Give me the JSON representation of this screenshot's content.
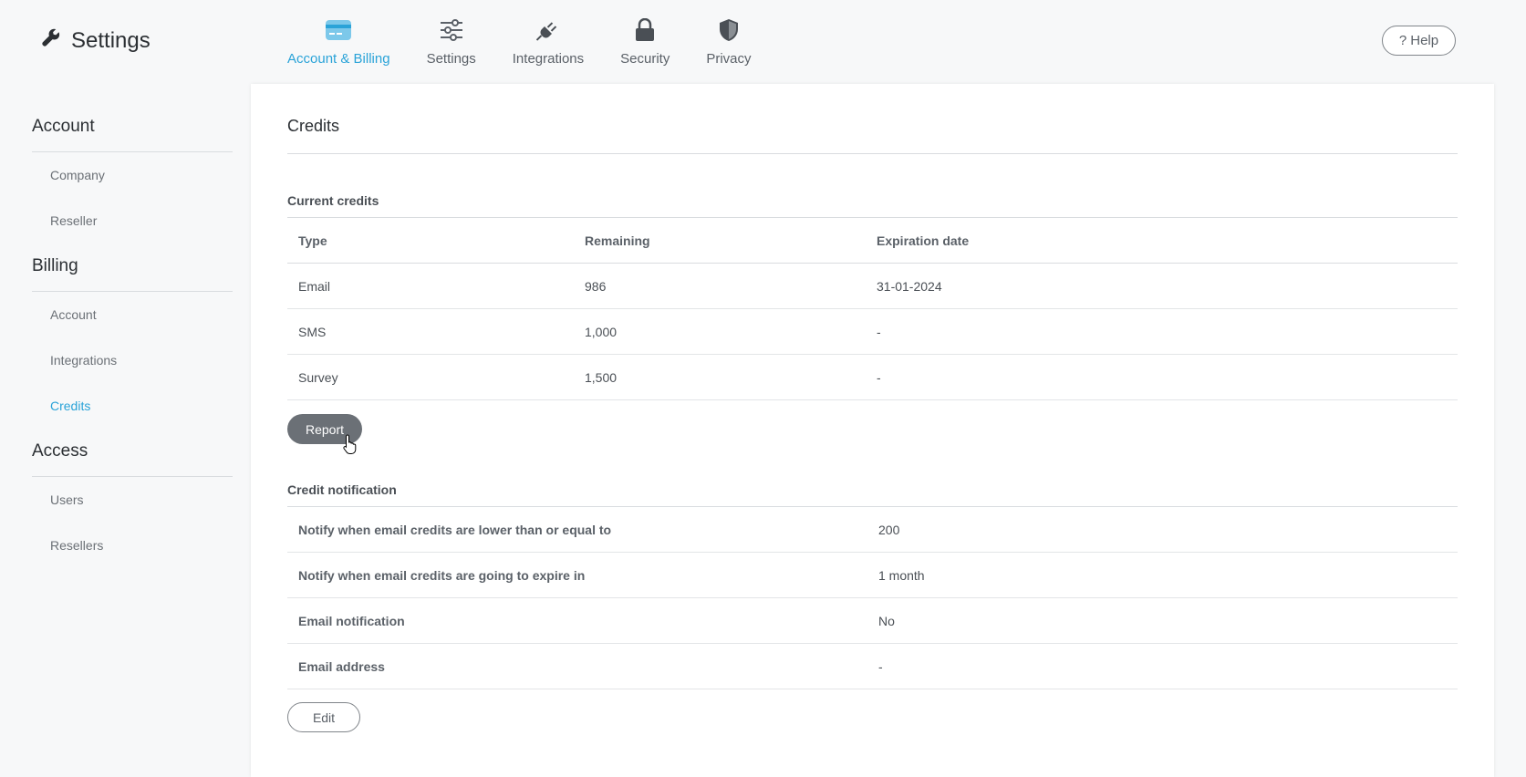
{
  "header": {
    "title": "Settings",
    "help_label": "Help",
    "tabs": [
      {
        "label": "Account & Billing",
        "icon": "credit-card-icon",
        "active": true
      },
      {
        "label": "Settings",
        "icon": "sliders-icon"
      },
      {
        "label": "Integrations",
        "icon": "plug-icon"
      },
      {
        "label": "Security",
        "icon": "lock-icon"
      },
      {
        "label": "Privacy",
        "icon": "shield-icon"
      }
    ]
  },
  "sidebar": {
    "sections": [
      {
        "title": "Account",
        "items": [
          "Company",
          "Reseller"
        ]
      },
      {
        "title": "Billing",
        "items": [
          "Account",
          "Integrations",
          "Credits"
        ]
      },
      {
        "title": "Access",
        "items": [
          "Users",
          "Resellers"
        ]
      }
    ],
    "active_item": "Credits"
  },
  "main": {
    "title": "Credits",
    "current_credits": {
      "title": "Current credits",
      "columns": [
        "Type",
        "Remaining",
        "Expiration date"
      ],
      "rows": [
        [
          "Email",
          "986",
          "31-01-2024"
        ],
        [
          "SMS",
          "1,000",
          "-"
        ],
        [
          "Survey",
          "1,500",
          "-"
        ]
      ],
      "report_label": "Report"
    },
    "credit_notification": {
      "title": "Credit notification",
      "rows": [
        [
          "Notify when email credits are lower than or equal to",
          "200"
        ],
        [
          "Notify when email credits are going to expire in",
          "1 month"
        ],
        [
          "Email notification",
          "No"
        ],
        [
          "Email address",
          "-"
        ]
      ],
      "edit_label": "Edit"
    }
  },
  "colors": {
    "accent": "#2aa3d8",
    "button_dark": "#6b7076"
  }
}
